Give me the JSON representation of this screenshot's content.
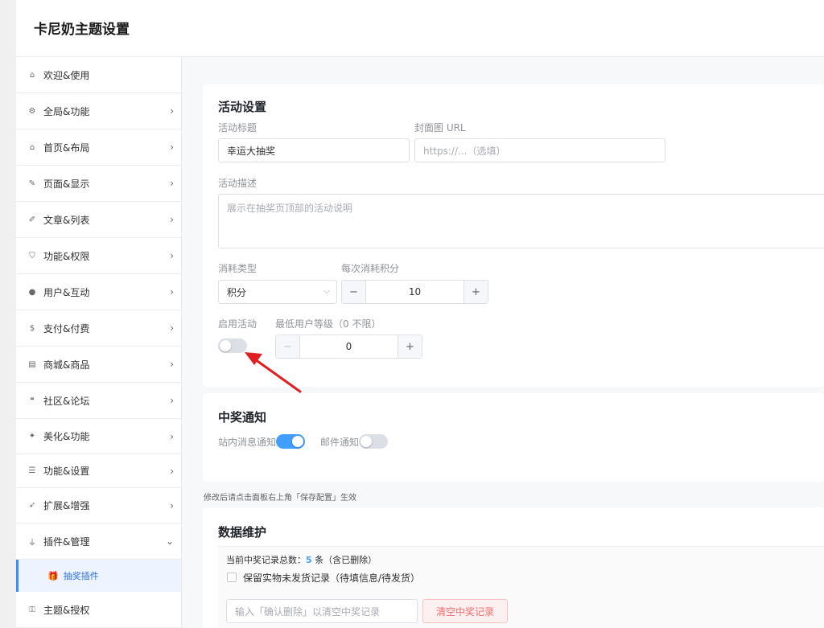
{
  "app": {
    "title": "卡尼奶主题设置"
  },
  "sidebar": {
    "items": [
      {
        "label": "欢迎&使用",
        "icon": "home-icon",
        "glyph": "⌂",
        "has_chevron": false
      },
      {
        "label": "全局&功能",
        "icon": "gear-icon",
        "glyph": "⚙",
        "has_chevron": true
      },
      {
        "label": "首页&布局",
        "icon": "house-icon",
        "glyph": "⌂",
        "has_chevron": true
      },
      {
        "label": "页面&显示",
        "icon": "pin-icon",
        "glyph": "✎",
        "has_chevron": true
      },
      {
        "label": "文章&列表",
        "icon": "pushpin-icon",
        "glyph": "✐",
        "has_chevron": true
      },
      {
        "label": "功能&权限",
        "icon": "shield-icon",
        "glyph": "⛉",
        "has_chevron": true
      },
      {
        "label": "用户&互动",
        "icon": "user-icon",
        "glyph": "●",
        "has_chevron": true
      },
      {
        "label": "支付&付费",
        "icon": "coin-icon",
        "glyph": "$",
        "has_chevron": true
      },
      {
        "label": "商城&商品",
        "icon": "store-icon",
        "glyph": "▤",
        "has_chevron": true
      },
      {
        "label": "社区&论坛",
        "icon": "comments-icon",
        "glyph": "❝",
        "has_chevron": true
      },
      {
        "label": "美化&功能",
        "icon": "magic-wand-icon",
        "glyph": "✦",
        "has_chevron": true
      },
      {
        "label": "功能&设置",
        "icon": "sliders-icon",
        "glyph": "☰",
        "has_chevron": true
      },
      {
        "label": "扩展&增强",
        "icon": "rocket-icon",
        "glyph": "➶",
        "has_chevron": true
      },
      {
        "label": "插件&管理",
        "icon": "plug-icon",
        "glyph": "⏚",
        "has_chevron": true,
        "expanded": true
      }
    ],
    "sub_item": {
      "label": "抽奖插件",
      "icon": "gift-icon",
      "glyph": "🎁"
    },
    "last_item": {
      "label": "主题&授权",
      "icon": "key-icon",
      "glyph": "⚿"
    }
  },
  "activity": {
    "title": "活动设置",
    "name_label": "活动标题",
    "name_value": "幸运大抽奖",
    "cover_label": "封面图 URL",
    "cover_placeholder": "https://...（选填）",
    "desc_label": "活动描述",
    "desc_placeholder": "展示在抽奖页顶部的活动说明",
    "cost_type_label": "消耗类型",
    "cost_type_value": "积分",
    "cost_per_label": "每次消耗积分",
    "cost_per_value": "10",
    "enable_label": "启用活动",
    "enable_on": false,
    "min_level_label": "最低用户等级（0 不限）",
    "min_level_value": "0"
  },
  "notify": {
    "title": "中奖通知",
    "site_label": "站内消息通知",
    "site_on": true,
    "mail_label": "邮件通知",
    "mail_on": false
  },
  "save_hint": "修改后请点击面板右上角「保存配置」生效",
  "maintenance": {
    "title": "数据维护",
    "stat_prefix": "当前中奖记录总数：",
    "stat_count": "5",
    "stat_suffix": " 条（含已删除）",
    "keep_label": "保留实物未发货记录（待填信息/待发货）",
    "confirm_placeholder": "输入「确认删除」以清空中奖记录",
    "clear_button": "清空中奖记录"
  },
  "colors": {
    "accent": "#409eff",
    "danger": "#f56c6c",
    "annotation_arrow": "#e02020"
  }
}
